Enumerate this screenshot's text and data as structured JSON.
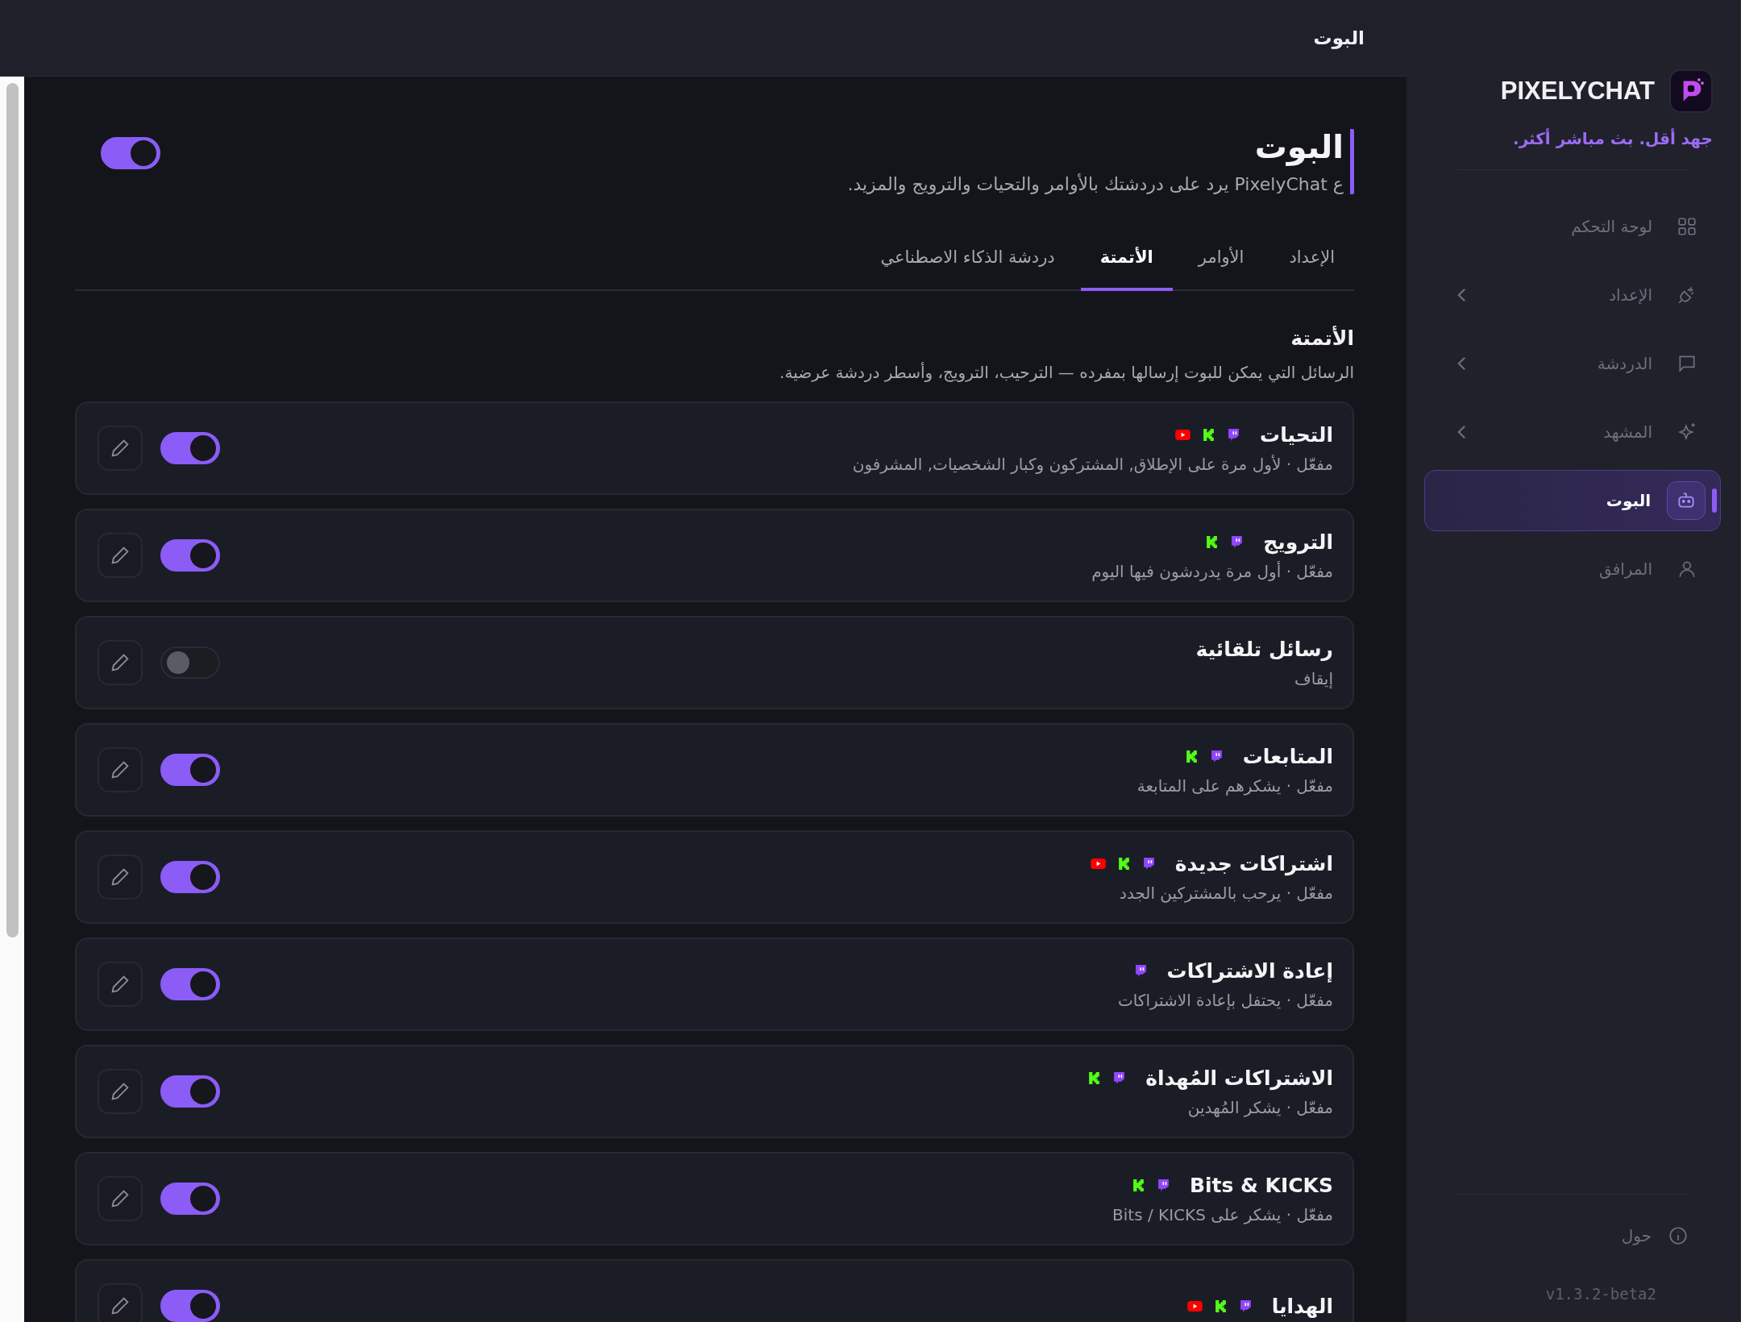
{
  "sidebar": {
    "brand": "PIXELYCHAT",
    "tagline": "جهد أقل. بث مباشر أكثر.",
    "items": [
      {
        "label": "لوحة التحكم",
        "kind": "grid",
        "expandable": false,
        "selected": false
      },
      {
        "label": "الإعداد",
        "kind": "plug",
        "expandable": true,
        "selected": false
      },
      {
        "label": "الدردشة",
        "kind": "message",
        "expandable": true,
        "selected": false
      },
      {
        "label": "المشهد",
        "kind": "sparkle",
        "expandable": true,
        "selected": false
      },
      {
        "label": "البوت",
        "kind": "robot",
        "expandable": false,
        "selected": true
      },
      {
        "label": "المرافق",
        "kind": "user",
        "expandable": false,
        "selected": false
      }
    ],
    "about": "حول",
    "version": "v1.3.2-beta2"
  },
  "topbar": {
    "title": "البوت"
  },
  "page": {
    "title": "البوت",
    "description": "ع PixelyChat يرد على دردشتك بالأوامر والتحيات والترويج والمزيد.",
    "enabled": true
  },
  "tabs": [
    {
      "label": "الإعداد",
      "selected": false
    },
    {
      "label": "الأوامر",
      "selected": false
    },
    {
      "label": "الأتمتة",
      "selected": true
    },
    {
      "label": "دردشة الذكاء الاصطناعي",
      "selected": false
    }
  ],
  "section": {
    "title": "الأتمتة",
    "description": "الرسائل التي يمكن للبوت إرسالها بمفرده — الترحيب، الترويج، وأسطر دردشة عرضية."
  },
  "automations": [
    {
      "title": "التحيات",
      "platforms": [
        {
          "kind": "twitch"
        },
        {
          "kind": "kick"
        },
        {
          "kind": "youtube"
        }
      ],
      "status": "مفعّل · لأول مرة على الإطلاق, المشتركون وكبار الشخصيات, المشرفون",
      "on": true
    },
    {
      "title": "الترويج",
      "platforms": [
        {
          "kind": "twitch"
        },
        {
          "kind": "kick"
        }
      ],
      "status": "مفعّل · أول مرة يدردشون فيها اليوم",
      "on": true
    },
    {
      "title": "رسائل تلقائية",
      "status": "إيقاف",
      "on": false
    },
    {
      "title": "المتابعات",
      "platforms": [
        {
          "kind": "twitch"
        },
        {
          "kind": "kick"
        }
      ],
      "status": "مفعّل · يشكرهم على المتابعة",
      "on": true
    },
    {
      "title": "اشتراكات جديدة",
      "platforms": [
        {
          "kind": "twitch"
        },
        {
          "kind": "kick"
        },
        {
          "kind": "youtube"
        }
      ],
      "status": "مفعّل · يرحب بالمشتركين الجدد",
      "on": true
    },
    {
      "title": "إعادة الاشتراكات",
      "platforms": [
        {
          "kind": "twitch"
        }
      ],
      "status": "مفعّل · يحتفل بإعادة الاشتراكات",
      "on": true
    },
    {
      "title": "الاشتراكات المُهداة",
      "platforms": [
        {
          "kind": "twitch"
        },
        {
          "kind": "kick"
        }
      ],
      "status": "مفعّل · يشكر المُهدين",
      "on": true
    },
    {
      "title": "Bits & KICKS",
      "platforms": [
        {
          "kind": "twitch"
        },
        {
          "kind": "kick"
        }
      ],
      "status": "مفعّل · يشكر على Bits / KICKS",
      "on": true
    },
    {
      "title": "الهدايا",
      "platforms": [
        {
          "kind": "twitch"
        },
        {
          "kind": "kick"
        },
        {
          "kind": "youtube"
        }
      ],
      "on": true
    }
  ]
}
